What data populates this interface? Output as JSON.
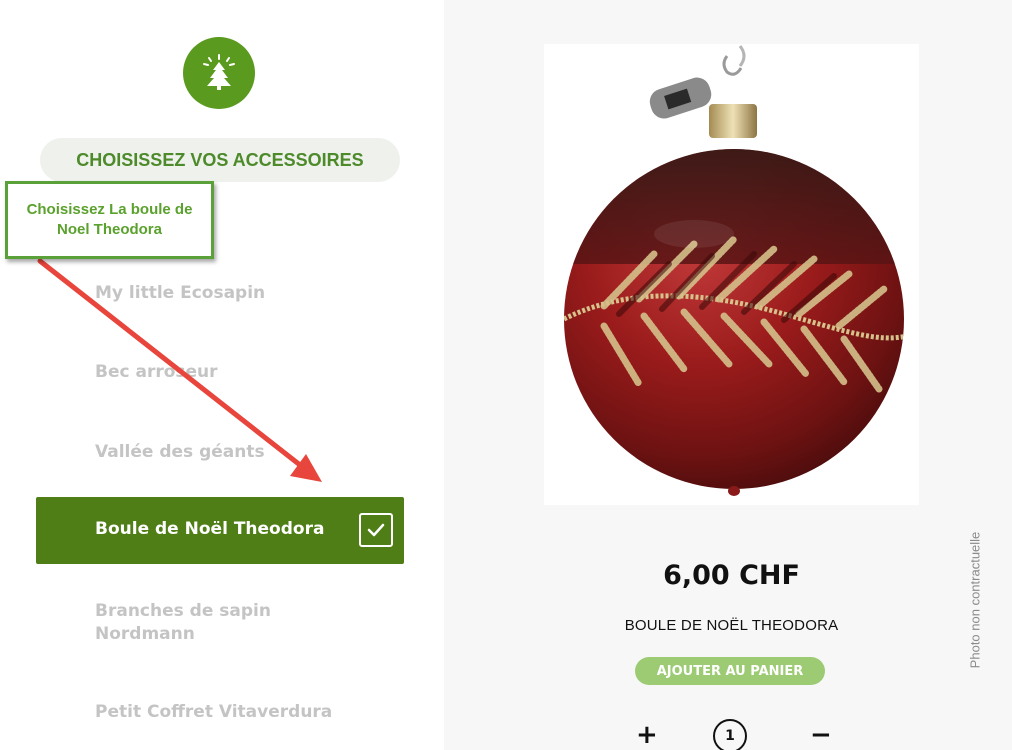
{
  "logo": {
    "icon": "christmas-tree-icon",
    "color": "#5a9a1e"
  },
  "section": {
    "title": "CHOISISSEZ VOS ACCESSOIRES"
  },
  "annotation": {
    "text": "Choisissez La boule de Noel Theodora"
  },
  "options": [
    {
      "label": "My little Ecosapin",
      "selected": false
    },
    {
      "label": "Bec arroseur",
      "selected": false
    },
    {
      "label": "Vallée des géants",
      "selected": false
    },
    {
      "label": "Boule de Noël Theodora",
      "selected": true
    },
    {
      "label": "Branches de sapin Nordmann",
      "selected": false
    },
    {
      "label": "Petit Coffret Vitaverdura",
      "selected": false
    }
  ],
  "product": {
    "price": "6,00 CHF",
    "name": "BOULE DE NOËL THEODORA",
    "add_to_cart": "AJOUTER AU PANIER",
    "quantity": "1",
    "plus": "+",
    "minus": "−",
    "disclaimer": "Photo non contractuelle"
  },
  "colors": {
    "accent": "#4f7e16",
    "button": "#9ccb74",
    "annotation": "#5aa12d",
    "arrow": "#e8453c"
  }
}
